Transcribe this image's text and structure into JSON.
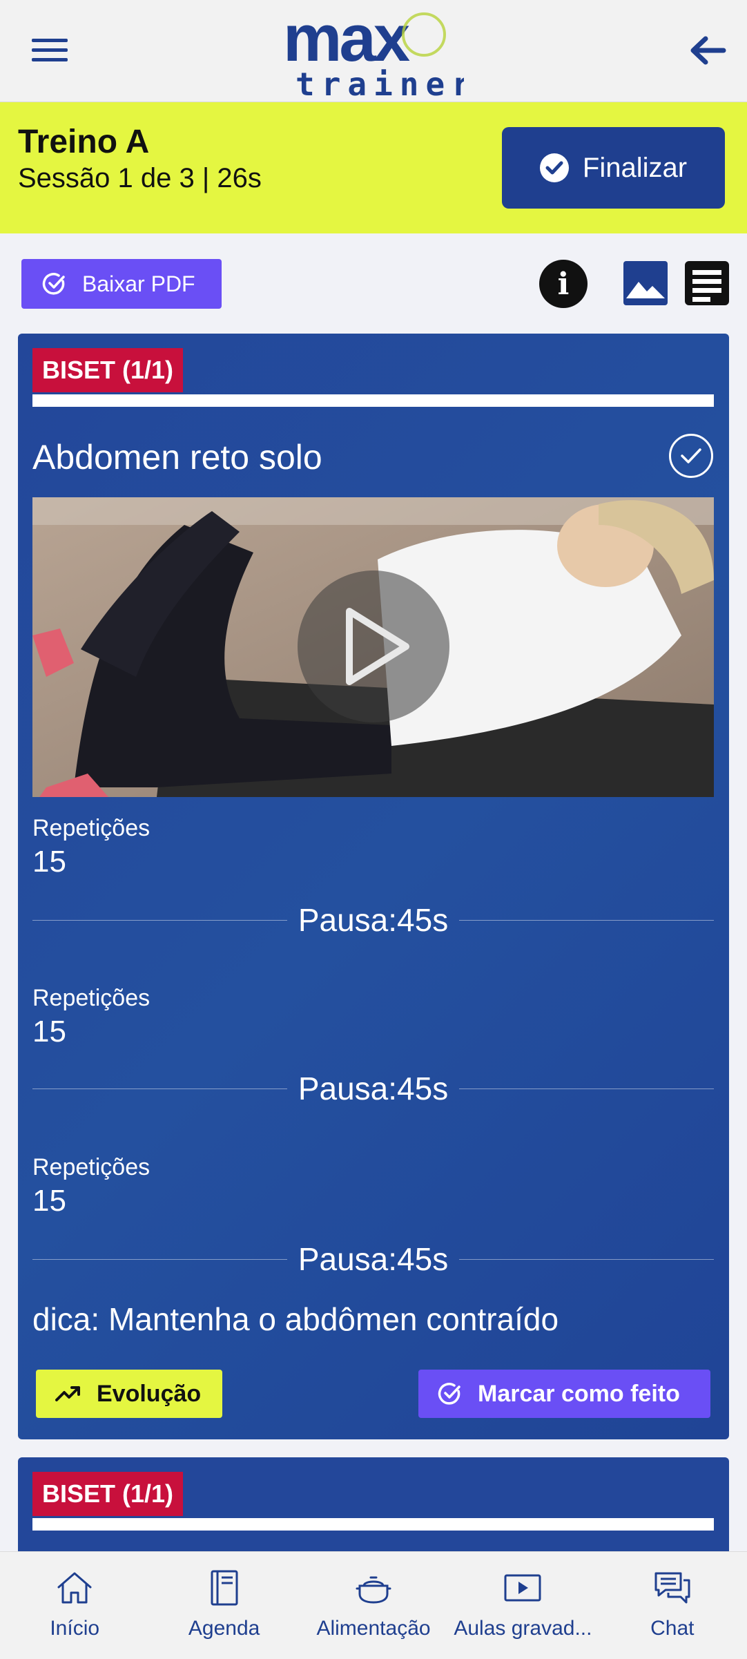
{
  "header": {
    "logo_top": "max",
    "logo_bottom": "trainer"
  },
  "workout": {
    "title": "Treino A",
    "session": "Sessão 1 de 3 | 26s",
    "finish_label": "Finalizar"
  },
  "toolbar": {
    "pdf_label": "Baixar PDF",
    "info_glyph": "i"
  },
  "exercise": {
    "badge": "BISET (1/1)",
    "name": "Abdomen reto solo",
    "sets": [
      {
        "label": "Repetições",
        "value": "15",
        "pause": "Pausa:45s"
      },
      {
        "label": "Repetições",
        "value": "15",
        "pause": "Pausa:45s"
      },
      {
        "label": "Repetições",
        "value": "15",
        "pause": "Pausa:45s"
      }
    ],
    "tip": "dica: Mantenha o abdômen contraído",
    "evolution_label": "Evolução",
    "mark_done_label": "Marcar como feito"
  },
  "next_exercise": {
    "badge": "BISET (1/1)"
  },
  "bottom_nav": [
    {
      "label": "Início",
      "icon": "home-icon"
    },
    {
      "label": "Agenda",
      "icon": "book-icon"
    },
    {
      "label": "Alimentação",
      "icon": "food-pot-icon"
    },
    {
      "label": "Aulas gravad...",
      "icon": "video-icon"
    },
    {
      "label": "Chat",
      "icon": "chat-icon"
    }
  ],
  "colors": {
    "primary_blue": "#1f3f8f",
    "accent_yellow": "#e4f641",
    "accent_purple": "#6a4ff5",
    "badge_red": "#c8103c"
  }
}
